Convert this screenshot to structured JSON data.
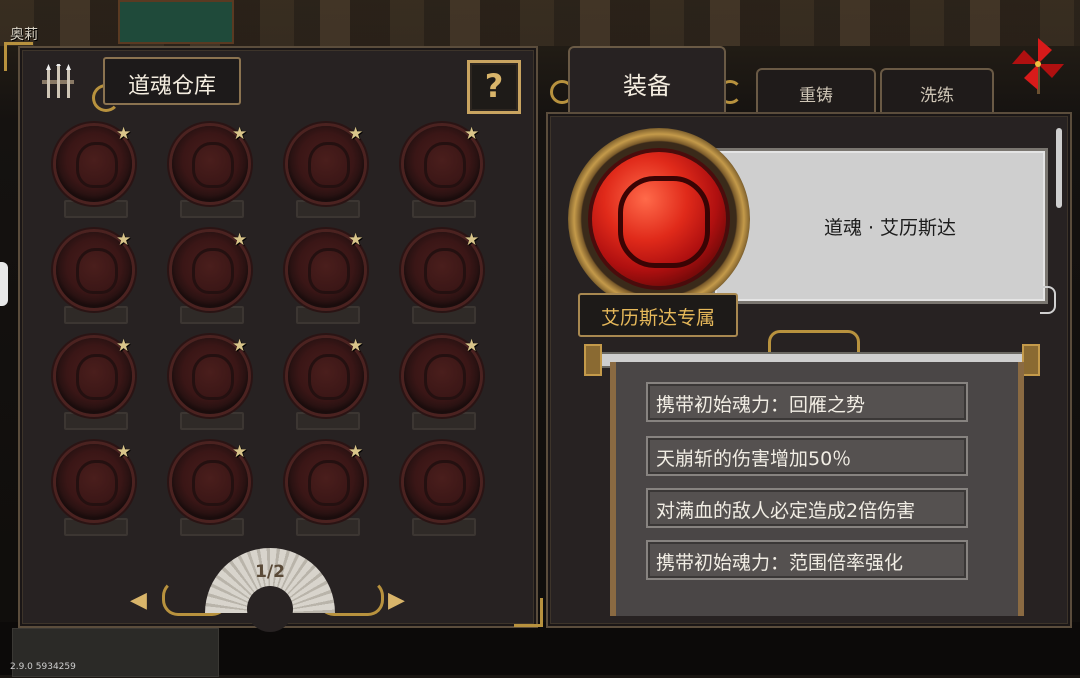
{
  "header": {
    "player_name": "奥莉"
  },
  "footer": {
    "version": "2.9.0 5934259"
  },
  "storage": {
    "title": "道魂仓库",
    "help_label": "?",
    "page": "1/2",
    "souls": [
      {
        "id": 1,
        "starred": true
      },
      {
        "id": 2,
        "starred": true
      },
      {
        "id": 3,
        "starred": true
      },
      {
        "id": 4,
        "starred": true
      },
      {
        "id": 5,
        "starred": true
      },
      {
        "id": 6,
        "starred": true
      },
      {
        "id": 7,
        "starred": true
      },
      {
        "id": 8,
        "starred": true
      },
      {
        "id": 9,
        "starred": true
      },
      {
        "id": 10,
        "starred": true
      },
      {
        "id": 11,
        "starred": true
      },
      {
        "id": 12,
        "starred": true
      },
      {
        "id": 13,
        "starred": true
      },
      {
        "id": 14,
        "starred": true
      },
      {
        "id": 15,
        "starred": true
      },
      {
        "id": 16,
        "starred": false
      }
    ],
    "star_glyph": "★",
    "prev_arrow": "◀",
    "next_arrow": "▶"
  },
  "tabs": {
    "equip": "装备",
    "recast": "重铸",
    "refine": "洗练"
  },
  "detail": {
    "soul_name": "道魂 · 艾历斯达",
    "exclusive_label": "艾历斯达专属",
    "effects": [
      "携带初始魂力：回雁之势",
      "天崩斩的伤害增加50％",
      "对满血的敌人必定造成2倍伤害",
      "携带初始魂力：范围倍率强化"
    ]
  },
  "colors": {
    "gold": "#d9b56a",
    "orb_red": "#e02a1a",
    "panel_bg": "#272222"
  }
}
